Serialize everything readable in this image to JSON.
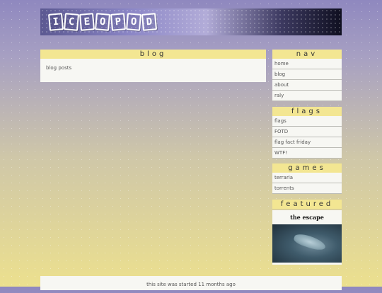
{
  "header": {
    "logo_letters": [
      "I",
      "C",
      "E",
      "O",
      "P",
      "O",
      "D"
    ]
  },
  "main": {
    "title": "blog",
    "content": "blog posts"
  },
  "sidebar": {
    "nav": {
      "title": "nav",
      "items": [
        "home",
        "blog",
        "about",
        "raly"
      ]
    },
    "flags": {
      "title": "flags",
      "items": [
        "flags",
        "FOTD",
        "flag fact friday",
        "WTF!"
      ]
    },
    "games": {
      "title": "games",
      "items": [
        "terraria",
        "torrents"
      ]
    },
    "featured": {
      "title": "featured",
      "card_title": "the escape"
    }
  },
  "footer": {
    "text": "this site was started 11 months ago"
  }
}
